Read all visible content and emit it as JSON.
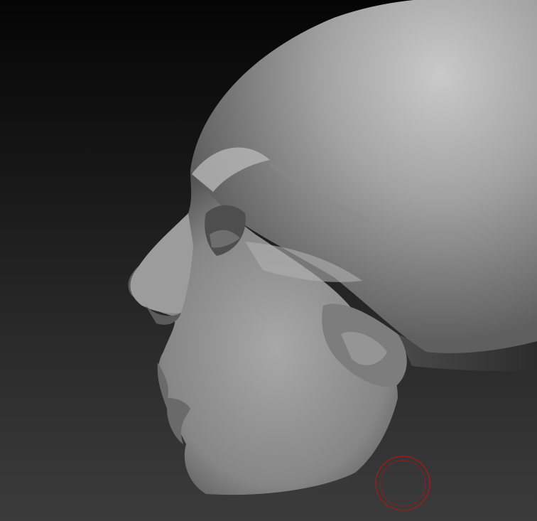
{
  "viewport": {
    "background_top": "#050505",
    "background_bottom": "#3b3b3b"
  },
  "model": {
    "subject": "sculpted-head-profile",
    "material_color": "#9a9a9a",
    "highlight_color": "#cfcfcf",
    "shadow_color": "#3c3c3c"
  },
  "brush_cursor": {
    "icon": "brush-circle-icon",
    "color": "#a11a1a"
  }
}
